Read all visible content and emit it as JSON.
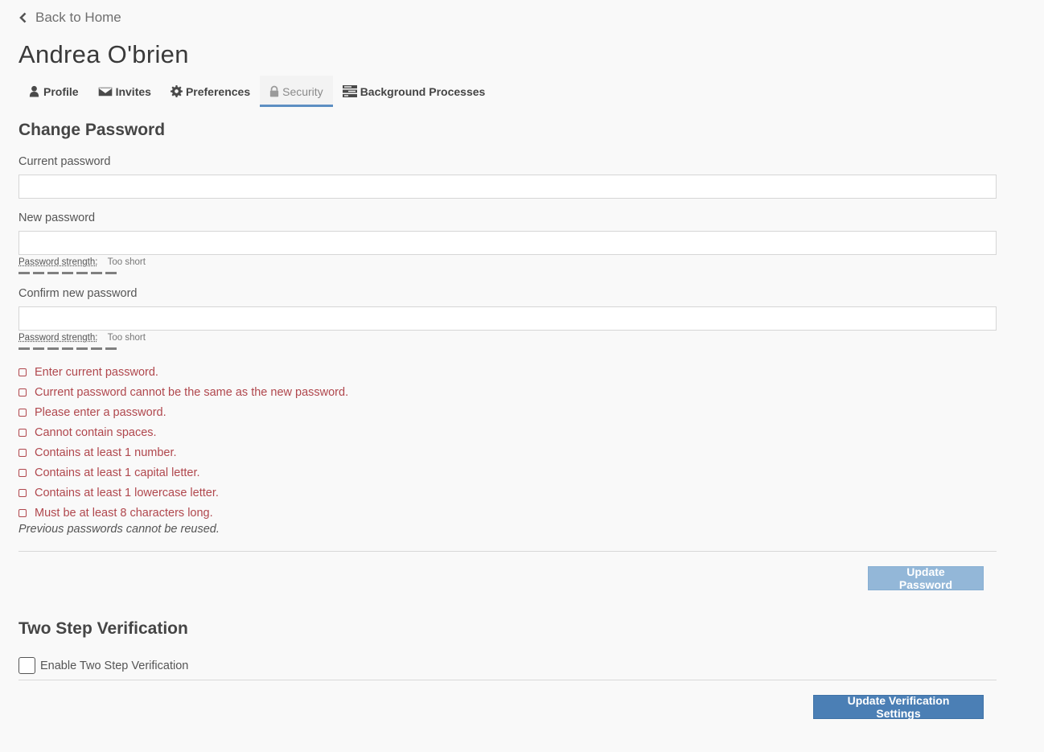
{
  "nav": {
    "back_label": "Back to Home",
    "back_icon": "chevron-left-icon"
  },
  "user": {
    "name": "Andrea O'brien"
  },
  "tabs": [
    {
      "label": "Profile",
      "icon": "user-icon",
      "active": false
    },
    {
      "label": "Invites",
      "icon": "envelope-icon",
      "active": false
    },
    {
      "label": "Preferences",
      "icon": "gear-icon",
      "active": false
    },
    {
      "label": "Security",
      "icon": "lock-icon",
      "active": true
    },
    {
      "label": "Background Processes",
      "icon": "tasks-icon",
      "active": false
    }
  ],
  "change_password": {
    "title": "Change Password",
    "current_label": "Current password",
    "current_value": "",
    "new_label": "New password",
    "new_value": "",
    "confirm_label": "Confirm new password",
    "confirm_value": "",
    "strength_label": "Password strength:",
    "new_strength_value": "Too short",
    "confirm_strength_value": "Too short",
    "rules": [
      "Enter current password.",
      "Current password cannot be the same as the new password.",
      "Please enter a password.",
      "Cannot contain spaces.",
      "Contains at least 1 number.",
      "Contains at least 1 capital letter.",
      "Contains at least 1 lowercase letter.",
      "Must be at least 8 characters long."
    ],
    "note": "Previous passwords cannot be reused.",
    "submit_label": "Update Password",
    "submit_disabled": true
  },
  "two_step": {
    "title": "Two Step Verification",
    "checkbox_label": "Enable Two Step Verification",
    "enabled": false,
    "submit_label": "Update Verification Settings"
  },
  "colors": {
    "accent": "#4b7fb5",
    "accent_disabled": "#93b7d8",
    "error": "#b0474d",
    "active_tab_border": "#5d8fc2"
  }
}
